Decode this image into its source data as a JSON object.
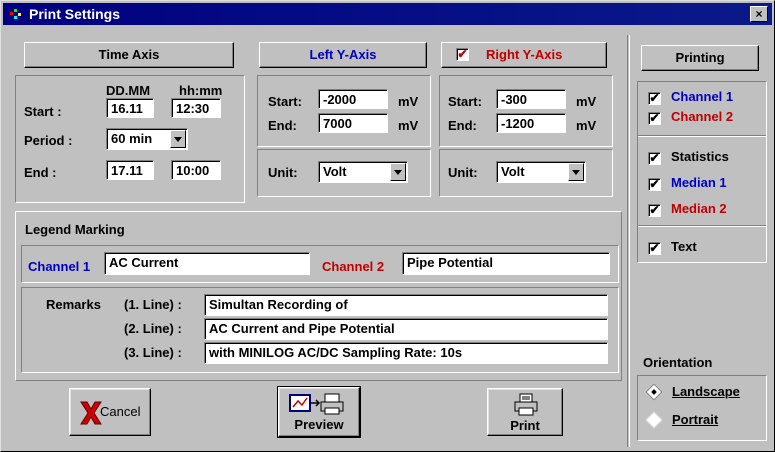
{
  "window": {
    "title": "Print Settings",
    "close_label": "×"
  },
  "time_axis": {
    "header": "Time Axis",
    "col_date": "DD.MM",
    "col_time": "hh:mm",
    "start_label": "Start :",
    "start_date": "16.11",
    "start_time": "12:30",
    "period_label": "Period :",
    "period_value": "60 min",
    "end_label": "End :",
    "end_date": "17.11",
    "end_time": "10:00"
  },
  "left_y": {
    "header": "Left Y-Axis",
    "start_label": "Start:",
    "start_value": "-2000",
    "start_unit": "mV",
    "end_label": "End:",
    "end_value": "7000",
    "end_unit": "mV",
    "unit_label": "Unit:",
    "unit_value": "Volt"
  },
  "right_y": {
    "header": "Right Y-Axis",
    "checked": "✔",
    "start_label": "Start:",
    "start_value": "-300",
    "start_unit": "mV",
    "end_label": "End:",
    "end_value": "-1200",
    "end_unit": "mV",
    "unit_label": "Unit:",
    "unit_value": "Volt"
  },
  "printing": {
    "header": "Printing",
    "check_mark": "✔",
    "channel1": "Channel 1",
    "channel2": "Channel 2",
    "statistics": "Statistics",
    "median1": "Median 1",
    "median2": "Median 2",
    "text": "Text"
  },
  "legend": {
    "title": "Legend Marking",
    "channel1_label": "Channel 1",
    "channel1_value": "AC Current",
    "channel2_label": "Channel 2",
    "channel2_value": "Pipe Potential",
    "remarks_label": "Remarks",
    "line1_label": "(1. Line) :",
    "line1_value": "Simultan Recording of",
    "line2_label": "(2. Line) :",
    "line2_value": "AC Current and Pipe Potential",
    "line3_label": "(3. Line) :",
    "line3_value": "with MINILOG AC/DC  Sampling Rate: 10s"
  },
  "orientation": {
    "title": "Orientation",
    "landscape": "Landscape",
    "portrait": "Portrait"
  },
  "buttons": {
    "cancel": "Cancel",
    "preview": "Preview",
    "print": "Print"
  },
  "colors": {
    "blue": "#0000c0",
    "red": "#c00000",
    "title_bg": "#000080"
  }
}
